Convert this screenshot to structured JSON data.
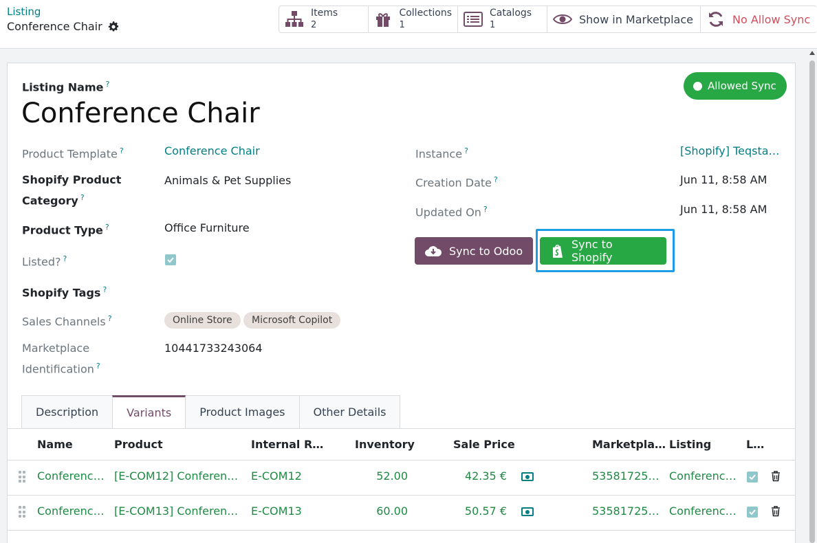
{
  "breadcrumb": {
    "parent": "Listing",
    "current": "Conference Chair"
  },
  "stats": {
    "items": {
      "label": "Items",
      "value": "2"
    },
    "collections": {
      "label": "Collections",
      "value": "1"
    },
    "catalogs": {
      "label": "Catalogs",
      "value": "1"
    },
    "marketplace": {
      "label": "Show in Marketplace"
    },
    "sync": {
      "label": "No Allow Sync"
    }
  },
  "status_badge": "Allowed Sync",
  "form": {
    "name_label": "Listing Name",
    "name": "Conference Chair",
    "product_template_label": "Product Template",
    "product_template": "Conference Chair",
    "category_label_line1": "Shopify Product",
    "category_label_line2": "Category",
    "category": "Animals & Pet Supplies",
    "product_type_label": "Product Type",
    "product_type": "Office Furniture",
    "listed_label": "Listed?",
    "tags_label": "Shopify Tags",
    "channels_label": "Sales Channels",
    "channels": [
      "Online Store",
      "Microsoft Copilot"
    ],
    "marketplace_id_label_line1": "Marketplace",
    "marketplace_id_label_line2": "Identification",
    "marketplace_id": "10441733243064",
    "instance_label": "Instance",
    "instance": "[Shopify] Teqsta…",
    "creation_label": "Creation Date",
    "creation": "Jun 11, 8:58 AM",
    "updated_label": "Updated On",
    "updated": "Jun 11, 8:58 AM",
    "sync_odoo": "Sync to Odoo",
    "sync_shopify": "Sync to Shopify"
  },
  "tabs": [
    "Description",
    "Variants",
    "Product Images",
    "Other Details"
  ],
  "table": {
    "headers": [
      "Name",
      "Product",
      "Internal R…",
      "Inventory",
      "Sale Price",
      "Marketpla…",
      "Listing",
      "L…"
    ],
    "rows": [
      {
        "name": "Conferenc…",
        "product": "[E-COM12] Conferen…",
        "ref": "E-COM12",
        "inventory": "52.00",
        "price": "42.35 €",
        "marketplace": "53581725…",
        "listing": "Conferenc…"
      },
      {
        "name": "Conferenc…",
        "product": "[E-COM13] Conferen…",
        "ref": "E-COM13",
        "inventory": "60.00",
        "price": "50.57 €",
        "marketplace": "53581725…",
        "listing": "Conferenc…"
      }
    ]
  },
  "colors": {
    "primary": "#714b67",
    "link": "#017e84",
    "success": "#28a745",
    "danger": "#d44c59"
  }
}
